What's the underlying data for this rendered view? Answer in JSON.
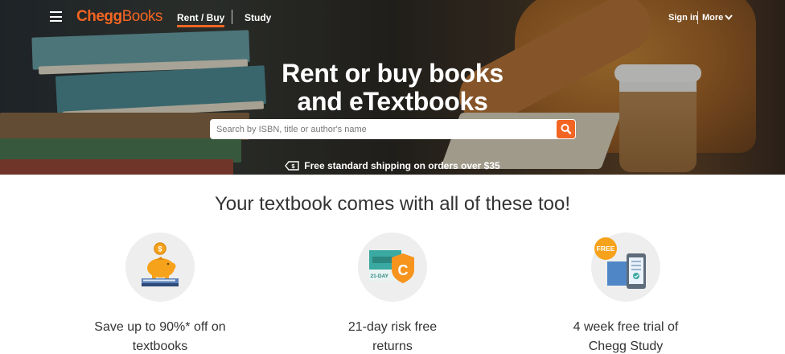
{
  "nav": {
    "menu_icon": "hamburger-icon",
    "logo_part1": "Chegg",
    "logo_part2": "Books",
    "rent_buy": "Rent / Buy",
    "study": "Study",
    "sign_in": "Sign in",
    "more": "More",
    "brand_color": "#f26522"
  },
  "hero": {
    "title_line1": "Rent or buy books",
    "title_line2": "and eTextbooks",
    "search_placeholder": "Search by ISBN, title or author's name",
    "search_icon": "search-icon",
    "shipping_text": "Free standard shipping on orders over $35"
  },
  "benefits": {
    "title": "Your textbook comes with all of these too!",
    "items": [
      {
        "icon": "piggy-bank-icon",
        "line1": "Save up to 90%* off on",
        "line2": "textbooks"
      },
      {
        "icon": "return-calendar-icon",
        "badge": "21-DAY",
        "line1": "21-day risk free",
        "line2": "returns"
      },
      {
        "icon": "free-trial-icon",
        "badge": "FREE",
        "line1": "4 week free trial of",
        "line2": "Chegg Study"
      }
    ]
  }
}
